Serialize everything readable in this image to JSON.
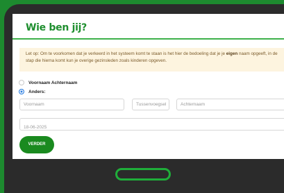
{
  "page": {
    "title": "Wie ben jij?",
    "notice": {
      "before_bold": "Let op: Om te voorkomen dat je verkeerd in het systeem komt te staan is het hier de bedoeling dat je je ",
      "bold": "eigen",
      "after_bold": " naam opgeeft, in de stap die hierna komt kun je overige gezinsleden zoals kinderen opgeven."
    },
    "options": [
      {
        "label": "Voornaam Achternaam",
        "selected": false
      },
      {
        "label": "Anders:",
        "selected": true
      }
    ],
    "fields": {
      "first_name_placeholder": "Voornaam",
      "infix_placeholder": "Tussenvoegsel",
      "last_name_placeholder": "Achternaam",
      "date_placeholder": "18-06-2025"
    },
    "submit_label": "VERDER"
  },
  "colors": {
    "brand_green": "#1f8f2f",
    "frame": "#2b2b2b",
    "notice_bg": "#fdf4df",
    "radio_selected": "#2a7de1"
  },
  "icons": {
    "home_button": "tablet-home-button"
  }
}
